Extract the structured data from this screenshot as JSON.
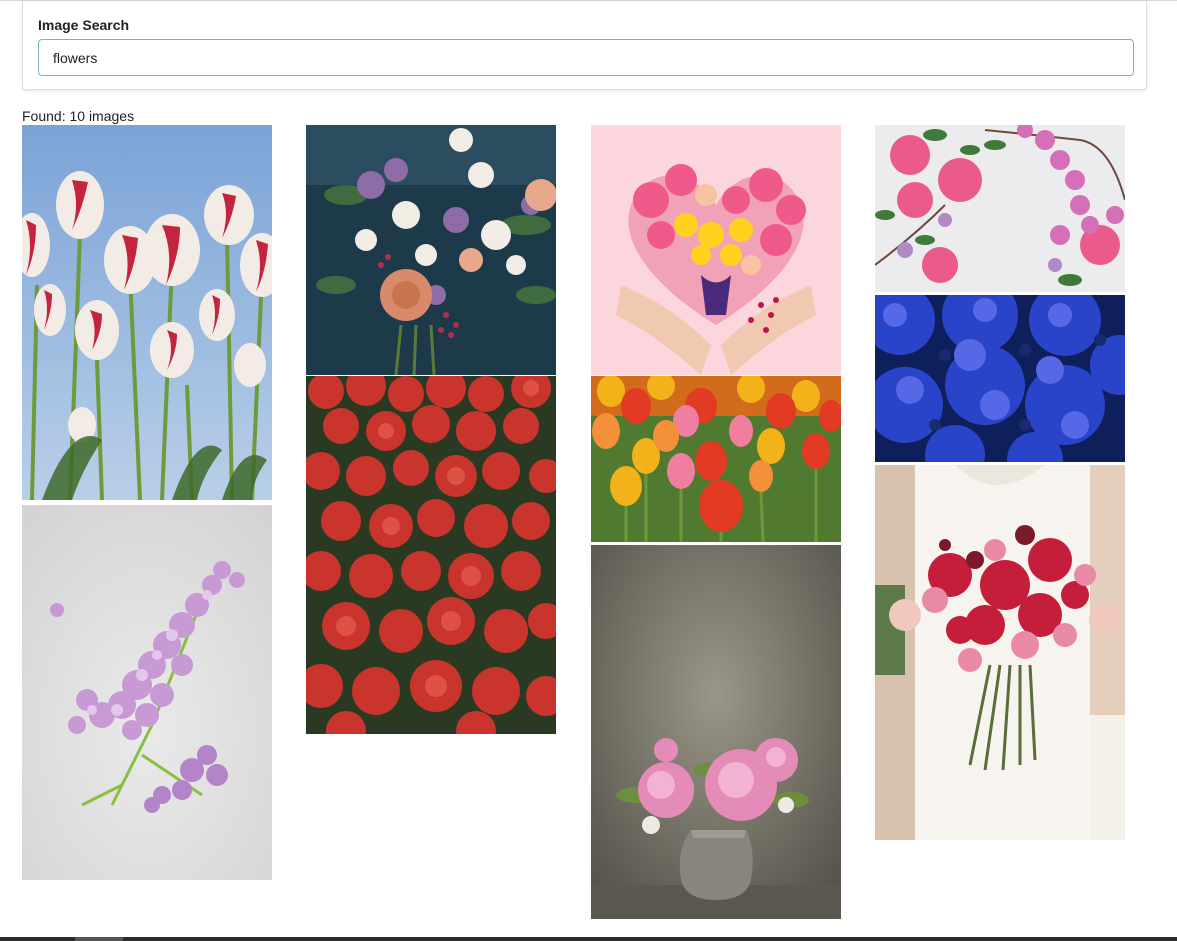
{
  "search": {
    "label": "Image Search",
    "value": "flowers",
    "placeholder": ""
  },
  "results": {
    "found_text": "Found: 10 images"
  }
}
